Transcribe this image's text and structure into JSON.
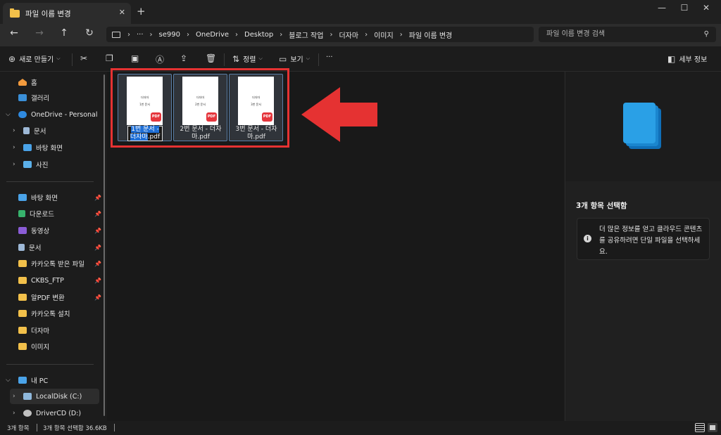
{
  "window": {
    "tab_title": "파일 이름 변경",
    "close_tab": "✕",
    "new_tab": "+",
    "minimize": "—",
    "maximize": "☐",
    "close": "✕"
  },
  "address": {
    "back": "←",
    "forward": "→",
    "up": "↑",
    "refresh": "↻",
    "more": "···",
    "breadcrumbs": [
      "se990",
      "OneDrive",
      "Desktop",
      "블로그 작업",
      "더자마",
      "이미지",
      "파일 이름 변경"
    ],
    "search_placeholder": "파일 이름 변경 검색"
  },
  "commands": {
    "new_label": "새로 만들기",
    "sort_label": "정렬",
    "view_label": "보기",
    "more": "···",
    "details_label": "세부 정보",
    "icons": [
      "add-icon",
      "cut-icon",
      "copy-icon",
      "paste-icon",
      "rename-icon",
      "share-icon",
      "delete-icon",
      "sort-icon",
      "view-icon",
      "details-pane-icon"
    ]
  },
  "sidebar": {
    "top": [
      {
        "label": "홈",
        "icon": "home-icon"
      },
      {
        "label": "갤러리",
        "icon": "gallery-icon"
      },
      {
        "label": "OneDrive - Personal",
        "icon": "cloud-icon"
      },
      {
        "label": "문서",
        "icon": "document-icon"
      },
      {
        "label": "바탕 화면",
        "icon": "desktop-icon"
      },
      {
        "label": "사진",
        "icon": "pictures-icon"
      }
    ],
    "quick": [
      {
        "label": "바탕 화면",
        "pinned": true,
        "color": "#4aa3e8"
      },
      {
        "label": "다운로드",
        "pinned": true,
        "color": "#37b26c"
      },
      {
        "label": "동영상",
        "pinned": true,
        "color": "#8a5cd6"
      },
      {
        "label": "문서",
        "pinned": true,
        "color": "#9db8d6"
      },
      {
        "label": "카카오톡 받은 파일",
        "pinned": true,
        "color": "#f2c04a"
      },
      {
        "label": "CKBS_FTP",
        "pinned": true,
        "color": "#f2c04a"
      },
      {
        "label": "알PDF 변환",
        "pinned": true,
        "color": "#f2c04a"
      },
      {
        "label": "카카오톡 설치",
        "pinned": false,
        "color": "#f2c04a"
      },
      {
        "label": "더자마",
        "pinned": false,
        "color": "#f2c04a"
      },
      {
        "label": "이미지",
        "pinned": false,
        "color": "#f2c04a"
      }
    ],
    "this_pc": {
      "label": "내 PC"
    },
    "drives": [
      {
        "label": "LocalDisk (C:)"
      },
      {
        "label": "DriverCD (D:)"
      }
    ]
  },
  "files": [
    {
      "thumb_line1": "더자마",
      "thumb_line2": "1번 문서",
      "badge": "PDF",
      "name_part1": "1번 문서 -",
      "name_part2": "더자마",
      "name_ext": ".pdf",
      "editing": true
    },
    {
      "thumb_line1": "더자마",
      "thumb_line2": "2번 문서",
      "badge": "PDF",
      "name": "2번 문서 - 더자마.pdf",
      "editing": false
    },
    {
      "thumb_line1": "더자마",
      "thumb_line2": "3번 문서",
      "badge": "PDF",
      "name": "3번 문서 - 더자마.pdf",
      "editing": false
    }
  ],
  "details": {
    "selected_title": "3개 항목 선택함",
    "info_text": "더 많은 정보를 얻고 클라우드 콘텐츠를 공유하려면 단일 파일을 선택하세요.",
    "info_icon": "i"
  },
  "status": {
    "item_count": "3개 항목",
    "selection": "3개 항목 선택함 36.6KB"
  },
  "colors": {
    "accent": "#1f6fd6",
    "highlight_frame": "#e53232",
    "folder": "#f2c04a",
    "pdf_badge": "#e5363d"
  }
}
